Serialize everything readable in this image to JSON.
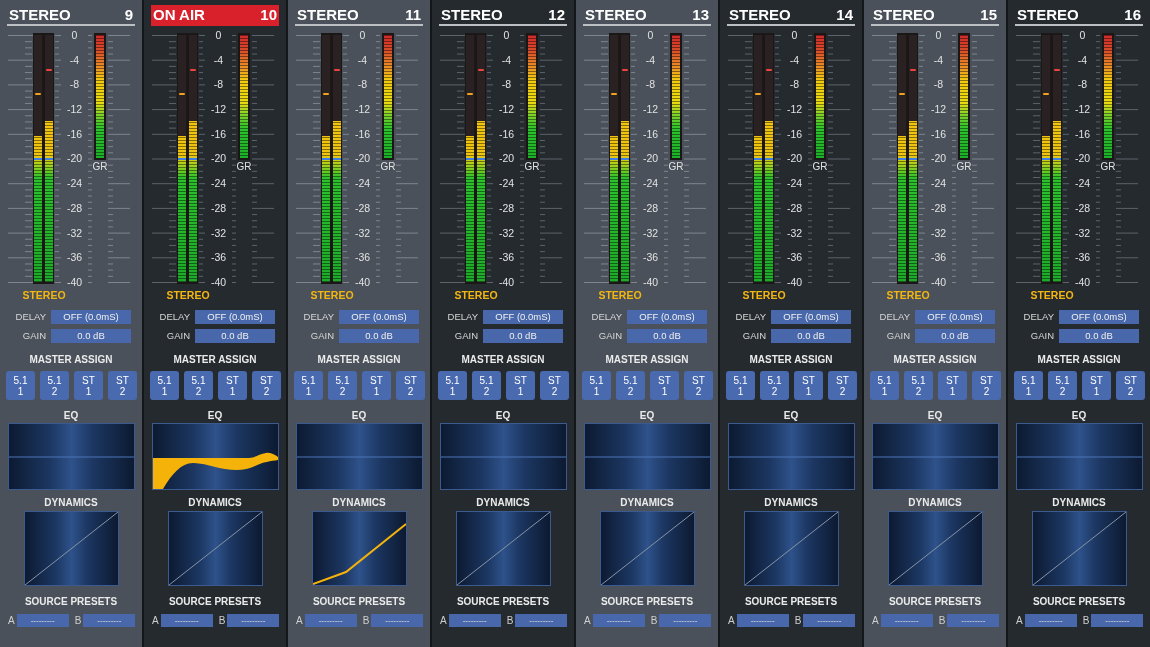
{
  "strips": [
    {
      "header": {
        "title": "STEREO",
        "number": "9",
        "on_air": false
      },
      "meter": {
        "left": {
          "level": 0.59,
          "peak": {
            "level": 0.76
          },
          "reference": {
            "level": 0.5
          }
        },
        "right": {
          "level": 0.65,
          "peak": {
            "level": 0.86
          },
          "reference": {
            "level": 0.5
          }
        },
        "scale": [
          "0",
          "-4",
          "-8",
          "-12",
          "-16",
          "-20",
          "-24",
          "-28",
          "-32",
          "-36",
          "-40"
        ],
        "gr": {
          "label": "GR",
          "level": 1
        },
        "format": "STEREO"
      },
      "delay": {
        "label": "DELAY",
        "value": "OFF (0.0mS)"
      },
      "gain": {
        "label": "GAIN",
        "value": "0.0 dB"
      },
      "master_assign": {
        "heading": "MASTER ASSIGN",
        "buttons": [
          {
            "lines": [
              "5.1",
              "1"
            ]
          },
          {
            "lines": [
              "5.1",
              "2"
            ]
          },
          {
            "lines": [
              "ST",
              "1"
            ]
          },
          {
            "lines": [
              "ST",
              "2"
            ]
          }
        ]
      },
      "eq": {
        "heading": "EQ",
        "active": false
      },
      "dynamics": {
        "heading": "DYNAMICS",
        "active": false
      },
      "source_presets": {
        "heading": "SOURCE PRESETS",
        "slots": [
          {
            "label": "A",
            "value": "---------"
          },
          {
            "label": "B",
            "value": "---------"
          }
        ]
      }
    },
    {
      "header": {
        "title": "ON AIR",
        "number": "10",
        "on_air": true
      },
      "meter": {
        "left": {
          "level": 0.59,
          "peak": {
            "level": 0.76
          },
          "reference": {
            "level": 0.5
          }
        },
        "right": {
          "level": 0.65,
          "peak": {
            "level": 0.86
          },
          "reference": {
            "level": 0.5
          }
        },
        "scale": [
          "0",
          "-4",
          "-8",
          "-12",
          "-16",
          "-20",
          "-24",
          "-28",
          "-32",
          "-36",
          "-40"
        ],
        "gr": {
          "label": "GR",
          "level": 1
        },
        "format": "STEREO"
      },
      "delay": {
        "label": "DELAY",
        "value": "OFF (0.0mS)"
      },
      "gain": {
        "label": "GAIN",
        "value": "0.0 dB"
      },
      "master_assign": {
        "heading": "MASTER ASSIGN",
        "buttons": [
          {
            "lines": [
              "5.1",
              "1"
            ]
          },
          {
            "lines": [
              "5.1",
              "2"
            ]
          },
          {
            "lines": [
              "ST",
              "1"
            ]
          },
          {
            "lines": [
              "ST",
              "2"
            ]
          }
        ]
      },
      "eq": {
        "heading": "EQ",
        "active": true
      },
      "dynamics": {
        "heading": "DYNAMICS",
        "active": false
      },
      "source_presets": {
        "heading": "SOURCE PRESETS",
        "slots": [
          {
            "label": "A",
            "value": "---------"
          },
          {
            "label": "B",
            "value": "---------"
          }
        ]
      }
    },
    {
      "header": {
        "title": "STEREO",
        "number": "11",
        "on_air": false
      },
      "meter": {
        "left": {
          "level": 0.59,
          "peak": {
            "level": 0.76
          },
          "reference": {
            "level": 0.5
          }
        },
        "right": {
          "level": 0.65,
          "peak": {
            "level": 0.86
          },
          "reference": {
            "level": 0.5
          }
        },
        "scale": [
          "0",
          "-4",
          "-8",
          "-12",
          "-16",
          "-20",
          "-24",
          "-28",
          "-32",
          "-36",
          "-40"
        ],
        "gr": {
          "label": "GR",
          "level": 1
        },
        "format": "STEREO"
      },
      "delay": {
        "label": "DELAY",
        "value": "OFF (0.0mS)"
      },
      "gain": {
        "label": "GAIN",
        "value": "0.0 dB"
      },
      "master_assign": {
        "heading": "MASTER ASSIGN",
        "buttons": [
          {
            "lines": [
              "5.1",
              "1"
            ]
          },
          {
            "lines": [
              "5.1",
              "2"
            ]
          },
          {
            "lines": [
              "ST",
              "1"
            ]
          },
          {
            "lines": [
              "ST",
              "2"
            ]
          }
        ]
      },
      "eq": {
        "heading": "EQ",
        "active": false
      },
      "dynamics": {
        "heading": "DYNAMICS",
        "active": true
      },
      "source_presets": {
        "heading": "SOURCE PRESETS",
        "slots": [
          {
            "label": "A",
            "value": "---------"
          },
          {
            "label": "B",
            "value": "---------"
          }
        ]
      }
    },
    {
      "header": {
        "title": "STEREO",
        "number": "12",
        "on_air": false
      },
      "meter": {
        "left": {
          "level": 0.59,
          "peak": {
            "level": 0.76
          },
          "reference": {
            "level": 0.5
          }
        },
        "right": {
          "level": 0.65,
          "peak": {
            "level": 0.86
          },
          "reference": {
            "level": 0.5
          }
        },
        "scale": [
          "0",
          "-4",
          "-8",
          "-12",
          "-16",
          "-20",
          "-24",
          "-28",
          "-32",
          "-36",
          "-40"
        ],
        "gr": {
          "label": "GR",
          "level": 1
        },
        "format": "STEREO"
      },
      "delay": {
        "label": "DELAY",
        "value": "OFF (0.0mS)"
      },
      "gain": {
        "label": "GAIN",
        "value": "0.0 dB"
      },
      "master_assign": {
        "heading": "MASTER ASSIGN",
        "buttons": [
          {
            "lines": [
              "5.1",
              "1"
            ]
          },
          {
            "lines": [
              "5.1",
              "2"
            ]
          },
          {
            "lines": [
              "ST",
              "1"
            ]
          },
          {
            "lines": [
              "ST",
              "2"
            ]
          }
        ]
      },
      "eq": {
        "heading": "EQ",
        "active": false
      },
      "dynamics": {
        "heading": "DYNAMICS",
        "active": false
      },
      "source_presets": {
        "heading": "SOURCE PRESETS",
        "slots": [
          {
            "label": "A",
            "value": "---------"
          },
          {
            "label": "B",
            "value": "---------"
          }
        ]
      }
    },
    {
      "header": {
        "title": "STEREO",
        "number": "13",
        "on_air": false
      },
      "meter": {
        "left": {
          "level": 0.59,
          "peak": {
            "level": 0.76
          },
          "reference": {
            "level": 0.5
          }
        },
        "right": {
          "level": 0.65,
          "peak": {
            "level": 0.86
          },
          "reference": {
            "level": 0.5
          }
        },
        "scale": [
          "0",
          "-4",
          "-8",
          "-12",
          "-16",
          "-20",
          "-24",
          "-28",
          "-32",
          "-36",
          "-40"
        ],
        "gr": {
          "label": "GR",
          "level": 1
        },
        "format": "STEREO"
      },
      "delay": {
        "label": "DELAY",
        "value": "OFF (0.0mS)"
      },
      "gain": {
        "label": "GAIN",
        "value": "0.0 dB"
      },
      "master_assign": {
        "heading": "MASTER ASSIGN",
        "buttons": [
          {
            "lines": [
              "5.1",
              "1"
            ]
          },
          {
            "lines": [
              "5.1",
              "2"
            ]
          },
          {
            "lines": [
              "ST",
              "1"
            ]
          },
          {
            "lines": [
              "ST",
              "2"
            ]
          }
        ]
      },
      "eq": {
        "heading": "EQ",
        "active": false
      },
      "dynamics": {
        "heading": "DYNAMICS",
        "active": false
      },
      "source_presets": {
        "heading": "SOURCE PRESETS",
        "slots": [
          {
            "label": "A",
            "value": "---------"
          },
          {
            "label": "B",
            "value": "---------"
          }
        ]
      }
    },
    {
      "header": {
        "title": "STEREO",
        "number": "14",
        "on_air": false
      },
      "meter": {
        "left": {
          "level": 0.59,
          "peak": {
            "level": 0.76
          },
          "reference": {
            "level": 0.5
          }
        },
        "right": {
          "level": 0.65,
          "peak": {
            "level": 0.86
          },
          "reference": {
            "level": 0.5
          }
        },
        "scale": [
          "0",
          "-4",
          "-8",
          "-12",
          "-16",
          "-20",
          "-24",
          "-28",
          "-32",
          "-36",
          "-40"
        ],
        "gr": {
          "label": "GR",
          "level": 1
        },
        "format": "STEREO"
      },
      "delay": {
        "label": "DELAY",
        "value": "OFF (0.0mS)"
      },
      "gain": {
        "label": "GAIN",
        "value": "0.0 dB"
      },
      "master_assign": {
        "heading": "MASTER ASSIGN",
        "buttons": [
          {
            "lines": [
              "5.1",
              "1"
            ]
          },
          {
            "lines": [
              "5.1",
              "2"
            ]
          },
          {
            "lines": [
              "ST",
              "1"
            ]
          },
          {
            "lines": [
              "ST",
              "2"
            ]
          }
        ]
      },
      "eq": {
        "heading": "EQ",
        "active": false
      },
      "dynamics": {
        "heading": "DYNAMICS",
        "active": false
      },
      "source_presets": {
        "heading": "SOURCE PRESETS",
        "slots": [
          {
            "label": "A",
            "value": "---------"
          },
          {
            "label": "B",
            "value": "---------"
          }
        ]
      }
    },
    {
      "header": {
        "title": "STEREO",
        "number": "15",
        "on_air": false
      },
      "meter": {
        "left": {
          "level": 0.59,
          "peak": {
            "level": 0.76
          },
          "reference": {
            "level": 0.5
          }
        },
        "right": {
          "level": 0.65,
          "peak": {
            "level": 0.86
          },
          "reference": {
            "level": 0.5
          }
        },
        "scale": [
          "0",
          "-4",
          "-8",
          "-12",
          "-16",
          "-20",
          "-24",
          "-28",
          "-32",
          "-36",
          "-40"
        ],
        "gr": {
          "label": "GR",
          "level": 1
        },
        "format": "STEREO"
      },
      "delay": {
        "label": "DELAY",
        "value": "OFF (0.0mS)"
      },
      "gain": {
        "label": "GAIN",
        "value": "0.0 dB"
      },
      "master_assign": {
        "heading": "MASTER ASSIGN",
        "buttons": [
          {
            "lines": [
              "5.1",
              "1"
            ]
          },
          {
            "lines": [
              "5.1",
              "2"
            ]
          },
          {
            "lines": [
              "ST",
              "1"
            ]
          },
          {
            "lines": [
              "ST",
              "2"
            ]
          }
        ]
      },
      "eq": {
        "heading": "EQ",
        "active": false
      },
      "dynamics": {
        "heading": "DYNAMICS",
        "active": false
      },
      "source_presets": {
        "heading": "SOURCE PRESETS",
        "slots": [
          {
            "label": "A",
            "value": "---------"
          },
          {
            "label": "B",
            "value": "---------"
          }
        ]
      }
    },
    {
      "header": {
        "title": "STEREO",
        "number": "16",
        "on_air": false
      },
      "meter": {
        "left": {
          "level": 0.59,
          "peak": {
            "level": 0.76
          },
          "reference": {
            "level": 0.5
          }
        },
        "right": {
          "level": 0.65,
          "peak": {
            "level": 0.86
          },
          "reference": {
            "level": 0.5
          }
        },
        "scale": [
          "0",
          "-4",
          "-8",
          "-12",
          "-16",
          "-20",
          "-24",
          "-28",
          "-32",
          "-36",
          "-40"
        ],
        "gr": {
          "label": "GR",
          "level": 1
        },
        "format": "STEREO"
      },
      "delay": {
        "label": "DELAY",
        "value": "OFF (0.0mS)"
      },
      "gain": {
        "label": "GAIN",
        "value": "0.0 dB"
      },
      "master_assign": {
        "heading": "MASTER ASSIGN",
        "buttons": [
          {
            "lines": [
              "5.1",
              "1"
            ]
          },
          {
            "lines": [
              "5.1",
              "2"
            ]
          },
          {
            "lines": [
              "ST",
              "1"
            ]
          },
          {
            "lines": [
              "ST",
              "2"
            ]
          }
        ]
      },
      "eq": {
        "heading": "EQ",
        "active": false
      },
      "dynamics": {
        "heading": "DYNAMICS",
        "active": false
      },
      "source_presets": {
        "heading": "SOURCE PRESETS",
        "slots": [
          {
            "label": "A",
            "value": "---------"
          },
          {
            "label": "B",
            "value": "---------"
          }
        ]
      }
    }
  ]
}
